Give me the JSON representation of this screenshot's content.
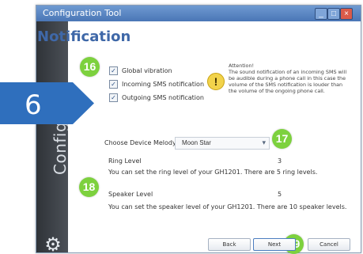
{
  "window": {
    "title": "Configuration Tool",
    "controls": {
      "minimize_icon": "_",
      "maximize_icon": "□",
      "close_icon": "×"
    }
  },
  "sidebar": {
    "label": "Configurati"
  },
  "page": {
    "heading": "Notification"
  },
  "callouts": {
    "step": "6",
    "b16": "16",
    "b17": "17",
    "b18": "18",
    "b19": "19"
  },
  "options": [
    {
      "label": "Global vibration",
      "checked": true
    },
    {
      "label": "Incoming SMS notification",
      "checked": true
    },
    {
      "label": "Outgoing SMS notification",
      "checked": true
    }
  ],
  "attention": {
    "title": "Attention!",
    "body": "The sound notification of an incoming SMS will be audible during a phone call in this case the volume of the SMS notification is louder than the volume of the ongoing phone call."
  },
  "melody": {
    "label": "Choose Device Melody",
    "value": "Moon Star"
  },
  "ring": {
    "label": "Ring Level",
    "value": "3",
    "hint": "You can set the ring level of your GH1201. There are 5 ring levels."
  },
  "speaker": {
    "label": "Speaker Level",
    "value": "5",
    "hint": "You can set the speaker level of your GH1201. There are 10 speaker levels."
  },
  "buttons": {
    "back": "Back",
    "next": "Next",
    "cancel": "Cancel"
  },
  "colors": {
    "accent": "#3f68a8",
    "badge": "#7dd13e",
    "callout": "#2f6fbd"
  },
  "icons": {
    "warning": "!",
    "gear": "⚙",
    "chevron": "▾",
    "check": "✓"
  }
}
